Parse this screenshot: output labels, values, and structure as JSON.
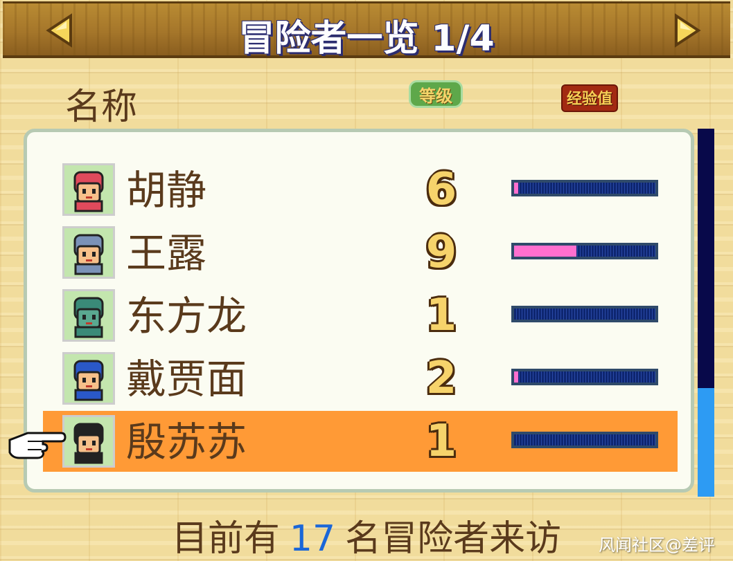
{
  "header": {
    "title": "冒险者一览",
    "page": "1/4",
    "prev_icon": "triangle-left-icon",
    "next_icon": "triangle-right-icon"
  },
  "columns": {
    "name": "名称",
    "level": "等级",
    "exp": "经验值"
  },
  "adventurers": [
    {
      "name": "胡静",
      "level": "6",
      "exp_fraction": 0.03,
      "selected": false,
      "hair": "#e04a5c",
      "skin": "#f7c08a"
    },
    {
      "name": "王露",
      "level": "9",
      "exp_fraction": 0.44,
      "selected": false,
      "hair": "#7b92b8",
      "skin": "#f7c08a"
    },
    {
      "name": "东方龙",
      "level": "1",
      "exp_fraction": 0.0,
      "selected": false,
      "hair": "#3a8a78",
      "skin": "#5aa890"
    },
    {
      "name": "戴贾面",
      "level": "2",
      "exp_fraction": 0.03,
      "selected": false,
      "hair": "#2a58c8",
      "skin": "#f7c08a"
    },
    {
      "name": "殷苏苏",
      "level": "1",
      "exp_fraction": 0.0,
      "selected": true,
      "hair": "#222222",
      "skin": "#f7c08a"
    }
  ],
  "scrollbar": {
    "thumb_start": 0.705,
    "thumb_end": 1.0
  },
  "footer": {
    "prefix": "目前有",
    "count": "17",
    "suffix": "名冒险者来访"
  },
  "watermark": "风闻社区@差评",
  "colors": {
    "selected_row": "#ff9a36",
    "exp_fill": "#ff6fcf",
    "scroll_thumb": "#2d9bf3",
    "count_text": "#1a66d8"
  },
  "icons": {
    "pointer": "pointing-hand-icon"
  }
}
